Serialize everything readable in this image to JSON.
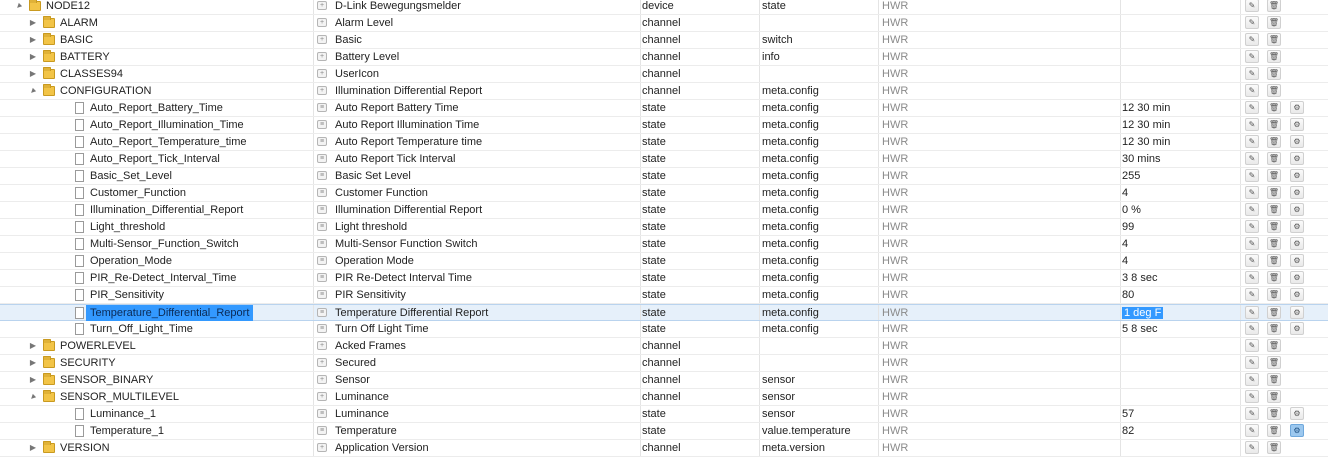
{
  "rows": [
    {
      "indent": 0,
      "expander": "expanded",
      "node": "folder",
      "id": "NODE12",
      "name": "D-Link Bewegungsmelder",
      "type": "device",
      "role": "state",
      "acl": "HWR",
      "value": "",
      "settings": false,
      "selected": false
    },
    {
      "indent": 1,
      "expander": "collapsed",
      "node": "folder",
      "id": "ALARM",
      "name": "Alarm Level",
      "type": "channel",
      "role": "",
      "acl": "HWR",
      "value": "",
      "settings": false,
      "selected": false
    },
    {
      "indent": 1,
      "expander": "collapsed",
      "node": "folder",
      "id": "BASIC",
      "name": "Basic",
      "type": "channel",
      "role": "switch",
      "acl": "HWR",
      "value": "",
      "settings": false,
      "selected": false
    },
    {
      "indent": 1,
      "expander": "collapsed",
      "node": "folder",
      "id": "BATTERY",
      "name": "Battery Level",
      "type": "channel",
      "role": "info",
      "acl": "HWR",
      "value": "",
      "settings": false,
      "selected": false
    },
    {
      "indent": 1,
      "expander": "collapsed",
      "node": "folder",
      "id": "CLASSES94",
      "name": "UserIcon",
      "type": "channel",
      "role": "",
      "acl": "HWR",
      "value": "",
      "settings": false,
      "selected": false
    },
    {
      "indent": 1,
      "expander": "expanded",
      "node": "folder",
      "id": "CONFIGURATION",
      "name": "Illumination Differential Report",
      "type": "channel",
      "role": "meta.config",
      "acl": "HWR",
      "value": "",
      "settings": false,
      "selected": false
    },
    {
      "indent": 2,
      "expander": "none",
      "node": "file",
      "id": "Auto_Report_Battery_Time",
      "name": "Auto Report Battery Time",
      "type": "state",
      "role": "meta.config",
      "acl": "HWR",
      "value": "12 30 min",
      "settings": true,
      "selected": false
    },
    {
      "indent": 2,
      "expander": "none",
      "node": "file",
      "id": "Auto_Report_Illumination_Time",
      "name": "Auto Report Illumination Time",
      "type": "state",
      "role": "meta.config",
      "acl": "HWR",
      "value": "12 30 min",
      "settings": true,
      "selected": false
    },
    {
      "indent": 2,
      "expander": "none",
      "node": "file",
      "id": "Auto_Report_Temperature_time",
      "name": "Auto Report Temperature time",
      "type": "state",
      "role": "meta.config",
      "acl": "HWR",
      "value": "12 30 min",
      "settings": true,
      "selected": false
    },
    {
      "indent": 2,
      "expander": "none",
      "node": "file",
      "id": "Auto_Report_Tick_Interval",
      "name": "Auto Report Tick Interval",
      "type": "state",
      "role": "meta.config",
      "acl": "HWR",
      "value": "30 mins",
      "settings": true,
      "selected": false
    },
    {
      "indent": 2,
      "expander": "none",
      "node": "file",
      "id": "Basic_Set_Level",
      "name": "Basic Set Level",
      "type": "state",
      "role": "meta.config",
      "acl": "HWR",
      "value": "255",
      "settings": true,
      "selected": false
    },
    {
      "indent": 2,
      "expander": "none",
      "node": "file",
      "id": "Customer_Function",
      "name": "Customer Function",
      "type": "state",
      "role": "meta.config",
      "acl": "HWR",
      "value": "4",
      "settings": true,
      "selected": false
    },
    {
      "indent": 2,
      "expander": "none",
      "node": "file",
      "id": "Illumination_Differential_Report",
      "name": "Illumination Differential Report",
      "type": "state",
      "role": "meta.config",
      "acl": "HWR",
      "value": "0 %",
      "settings": true,
      "selected": false
    },
    {
      "indent": 2,
      "expander": "none",
      "node": "file",
      "id": "Light_threshold",
      "name": "Light threshold",
      "type": "state",
      "role": "meta.config",
      "acl": "HWR",
      "value": "99",
      "settings": true,
      "selected": false
    },
    {
      "indent": 2,
      "expander": "none",
      "node": "file",
      "id": "Multi-Sensor_Function_Switch",
      "name": "Multi-Sensor Function Switch",
      "type": "state",
      "role": "meta.config",
      "acl": "HWR",
      "value": "4",
      "settings": true,
      "selected": false
    },
    {
      "indent": 2,
      "expander": "none",
      "node": "file",
      "id": "Operation_Mode",
      "name": "Operation Mode",
      "type": "state",
      "role": "meta.config",
      "acl": "HWR",
      "value": "4",
      "settings": true,
      "selected": false
    },
    {
      "indent": 2,
      "expander": "none",
      "node": "file",
      "id": "PIR_Re-Detect_Interval_Time",
      "name": "PIR Re-Detect Interval Time",
      "type": "state",
      "role": "meta.config",
      "acl": "HWR",
      "value": "3 8 sec",
      "settings": true,
      "selected": false
    },
    {
      "indent": 2,
      "expander": "none",
      "node": "file",
      "id": "PIR_Sensitivity",
      "name": "PIR Sensitivity",
      "type": "state",
      "role": "meta.config",
      "acl": "HWR",
      "value": "80",
      "settings": true,
      "selected": false
    },
    {
      "indent": 2,
      "expander": "none",
      "node": "file",
      "id": "Temperature_Differential_Report",
      "name": "Temperature Differential Report",
      "type": "state",
      "role": "meta.config",
      "acl": "HWR",
      "value": "1 deg F",
      "settings": true,
      "selected": true
    },
    {
      "indent": 2,
      "expander": "none",
      "node": "file",
      "id": "Turn_Off_Light_Time",
      "name": "Turn Off Light Time",
      "type": "state",
      "role": "meta.config",
      "acl": "HWR",
      "value": "5 8 sec",
      "settings": true,
      "selected": false
    },
    {
      "indent": 1,
      "expander": "collapsed",
      "node": "folder",
      "id": "POWERLEVEL",
      "name": "Acked Frames",
      "type": "channel",
      "role": "",
      "acl": "HWR",
      "value": "",
      "settings": false,
      "selected": false
    },
    {
      "indent": 1,
      "expander": "collapsed",
      "node": "folder",
      "id": "SECURITY",
      "name": "Secured",
      "type": "channel",
      "role": "",
      "acl": "HWR",
      "value": "",
      "settings": false,
      "selected": false
    },
    {
      "indent": 1,
      "expander": "collapsed",
      "node": "folder",
      "id": "SENSOR_BINARY",
      "name": "Sensor",
      "type": "channel",
      "role": "sensor",
      "acl": "HWR",
      "value": "",
      "settings": false,
      "selected": false
    },
    {
      "indent": 1,
      "expander": "expanded",
      "node": "folder",
      "id": "SENSOR_MULTILEVEL",
      "name": "Luminance",
      "type": "channel",
      "role": "sensor",
      "acl": "HWR",
      "value": "",
      "settings": false,
      "selected": false
    },
    {
      "indent": 2,
      "expander": "none",
      "node": "file",
      "id": "Luminance_1",
      "name": "Luminance",
      "type": "state",
      "role": "sensor",
      "acl": "HWR",
      "value": "57",
      "settings": true,
      "selected": false
    },
    {
      "indent": 2,
      "expander": "none",
      "node": "file",
      "id": "Temperature_1",
      "name": "Temperature",
      "type": "state",
      "role": "value.temperature",
      "acl": "HWR",
      "value": "82",
      "settings": true,
      "settingsActive": true,
      "selected": false
    },
    {
      "indent": 1,
      "expander": "collapsed",
      "node": "folder",
      "id": "VERSION",
      "name": "Application Version",
      "type": "channel",
      "role": "meta.version",
      "acl": "HWR",
      "value": "",
      "settings": false,
      "selected": false
    }
  ],
  "icons": {
    "expanded": "▲",
    "collapsed": "▶",
    "edit": "✎",
    "delete": "🗑",
    "settings": "⚙"
  },
  "colors": {
    "selection": "#3399ff",
    "folder": "#f2c447",
    "acl": "#8a8a8a"
  }
}
